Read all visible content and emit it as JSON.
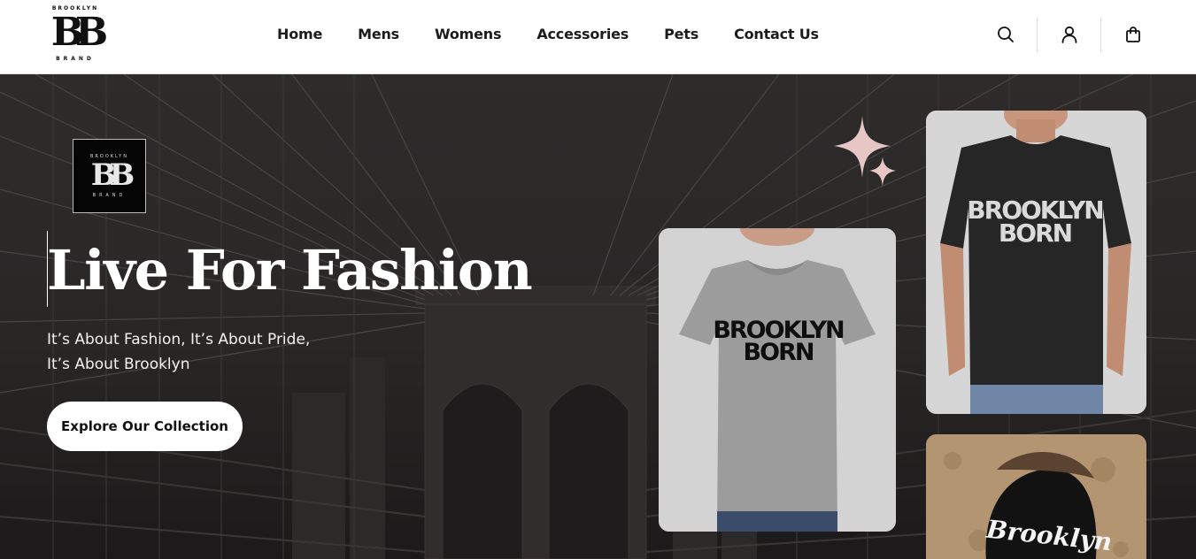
{
  "brand": {
    "top": "BROOKLYN",
    "mark": "BB",
    "bottom": "BRAND"
  },
  "nav": {
    "items": [
      {
        "label": "Home"
      },
      {
        "label": "Mens"
      },
      {
        "label": "Womens"
      },
      {
        "label": "Accessories"
      },
      {
        "label": "Pets"
      },
      {
        "label": "Contact Us"
      }
    ]
  },
  "header_icons": [
    "search-icon",
    "account-icon",
    "cart-bag-icon"
  ],
  "hero": {
    "badge": {
      "top": "BROOKLYN",
      "mark": "BB",
      "bottom": "BRAND"
    },
    "title": "Live For Fashion",
    "subtitle_line1": "It’s About Fashion, It’s About Pride,",
    "subtitle_line2": "It’s About Brooklyn",
    "cta_label": "Explore Our Collection"
  },
  "products": {
    "women_shirt_print": "BROOKLYN BORN",
    "men_shirt_print": "BROOKLYN BORN",
    "pet_shirt_print": "Brooklyn"
  },
  "colors": {
    "accent_sparkle": "#e7c6c6",
    "hero_overlay": "#262424",
    "cta_bg": "#ffffff"
  }
}
